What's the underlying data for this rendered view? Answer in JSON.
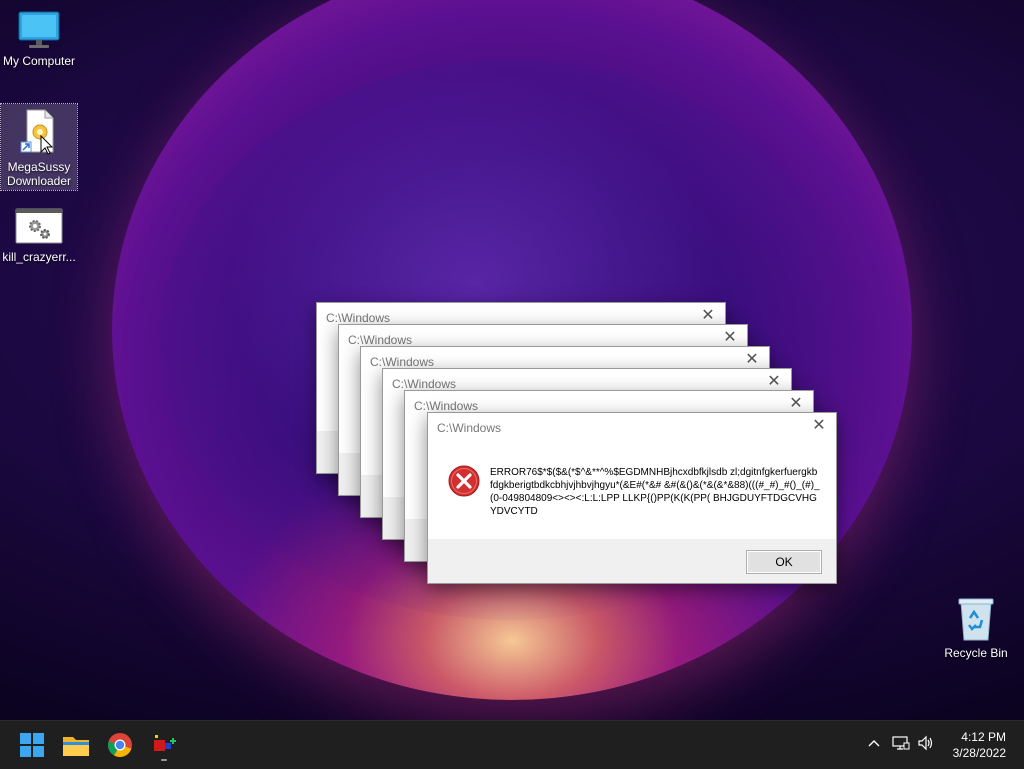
{
  "desktop": {
    "icons": [
      {
        "label": "My Computer"
      },
      {
        "label": "MegaSussy Downloader"
      },
      {
        "label": "kill_crazyerr..."
      },
      {
        "label": "Recycle Bin"
      }
    ]
  },
  "dialogs": {
    "title": "C:\\Windows",
    "message": "ERROR76$*$($&(*$^&**^%$EGDMNHBjhcxdbfkjlsdb zl;dgitnfgkerfuergkbfdgkberigtbdkcbhjvjhbvjhgyu*(&E#(*&# &#(&()&(*&(&*&88)(((#_#)_#()_(#)_(0-049804809<><><:L:L:LPP LLKP{()PP(K(K(PP( BHJGDUYFTDGCVHGYDVCYTD",
    "ok_label": "OK",
    "count": 6
  },
  "taskbar": {
    "apps": [
      {
        "icon": "windows-start-icon"
      },
      {
        "icon": "file-explorer-icon"
      },
      {
        "icon": "chrome-icon"
      },
      {
        "icon": "megasussy-app-icon"
      }
    ],
    "tray": {
      "icons": [
        "chevron-up-icon",
        "network-icon",
        "volume-icon"
      ],
      "time": "4:12 PM",
      "date": "3/28/2022"
    }
  },
  "colors": {
    "taskbar_bg": "#1f1f1f",
    "error_red": "#d32f2f",
    "dialog_bg": "#f0f0f0"
  }
}
